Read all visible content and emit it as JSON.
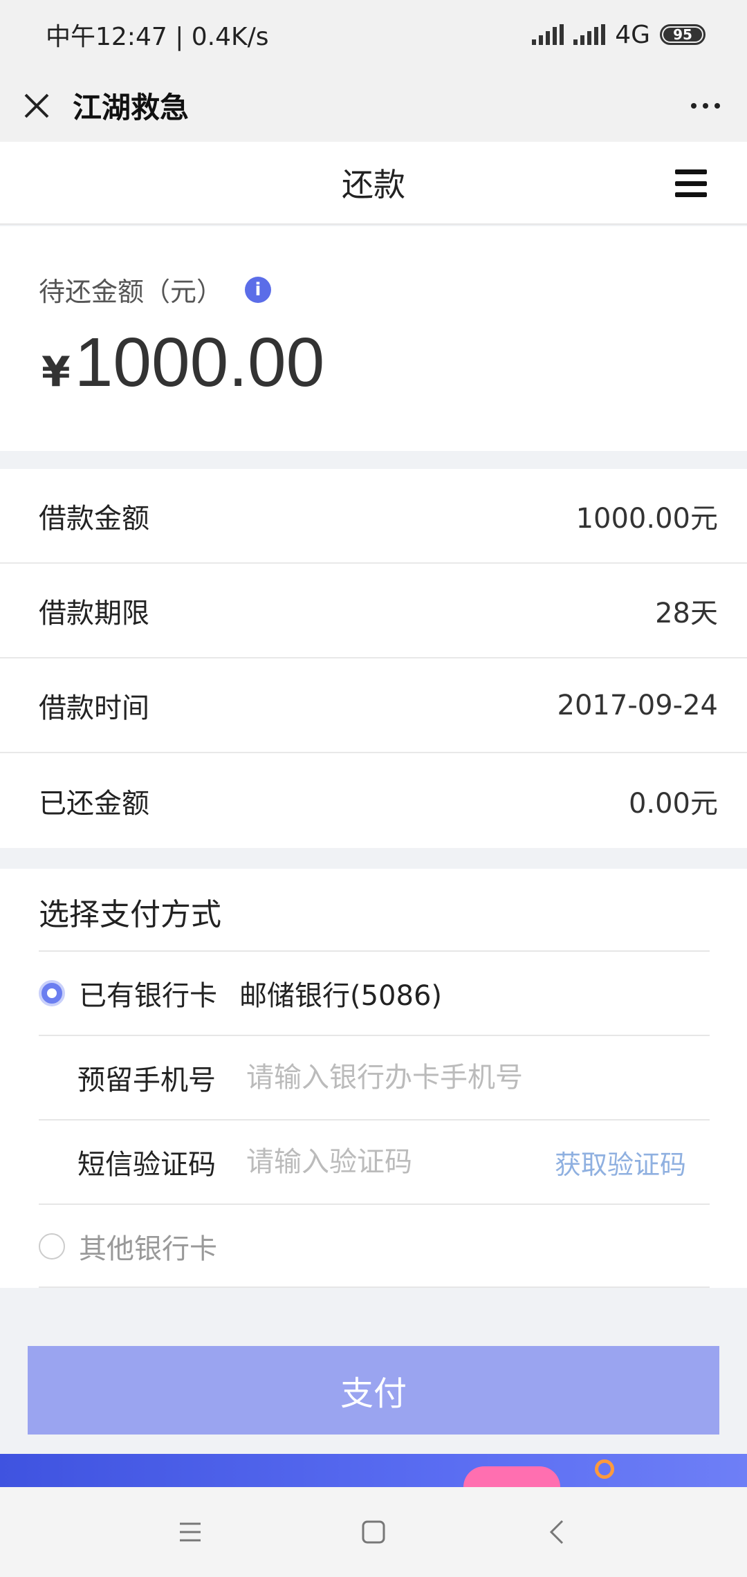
{
  "status_bar": {
    "time_speed": "中午12:47 | 0.4K/s",
    "network": "4G",
    "battery": "95"
  },
  "nav": {
    "title": "江湖救急"
  },
  "page": {
    "title": "还款"
  },
  "amount": {
    "label": "待还金额（元）",
    "currency": "¥",
    "value": "1000.00",
    "info_icon": "i"
  },
  "details": [
    {
      "label": "借款金额",
      "value": "1000.00元"
    },
    {
      "label": "借款期限",
      "value": "28天"
    },
    {
      "label": "借款时间",
      "value": "2017-09-24"
    },
    {
      "label": "已还金额",
      "value": "0.00元"
    }
  ],
  "payment": {
    "title": "选择支付方式",
    "existing_card_label": "已有银行卡",
    "existing_card_bank": "邮储银行(5086)",
    "phone_label": "预留手机号",
    "phone_placeholder": "请输入银行办卡手机号",
    "sms_label": "短信验证码",
    "sms_placeholder": "请输入验证码",
    "sms_button": "获取验证码",
    "other_card_label": "其他银行卡"
  },
  "pay_button": "支付",
  "colors": {
    "accent": "#6b7ef0",
    "pay_button": "#9aa4f0",
    "link": "#8fb0e0"
  }
}
